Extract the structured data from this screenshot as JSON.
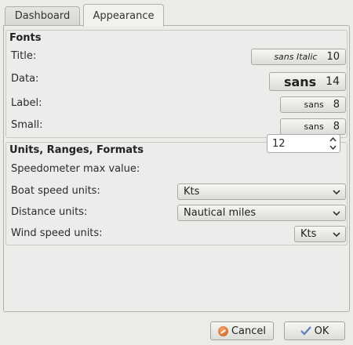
{
  "tabs": [
    {
      "label": "Dashboard"
    },
    {
      "label": "Appearance"
    }
  ],
  "fonts": {
    "title": "Fonts",
    "rows": [
      {
        "label": "Title:",
        "family": "sans Italic",
        "size": "10"
      },
      {
        "label": "Data:",
        "family": "sans",
        "size": "14"
      },
      {
        "label": "Label:",
        "family": "sans",
        "size": "8"
      },
      {
        "label": "Small:",
        "family": "sans",
        "size": "8"
      }
    ]
  },
  "units": {
    "title": "Units, Ranges, Formats",
    "speedometer_label": "Speedometer max value:",
    "speedometer_value": "12",
    "boat_speed_label": "Boat speed units:",
    "boat_speed_value": "Kts",
    "distance_label": "Distance units:",
    "distance_value": "Nautical miles",
    "wind_speed_label": "Wind speed units:",
    "wind_speed_value": "Kts"
  },
  "footer": {
    "cancel_label": "Cancel",
    "ok_label": "OK"
  },
  "colors": {
    "cancel_icon": "#d2691e",
    "ok_check": "#5a7fb8"
  }
}
